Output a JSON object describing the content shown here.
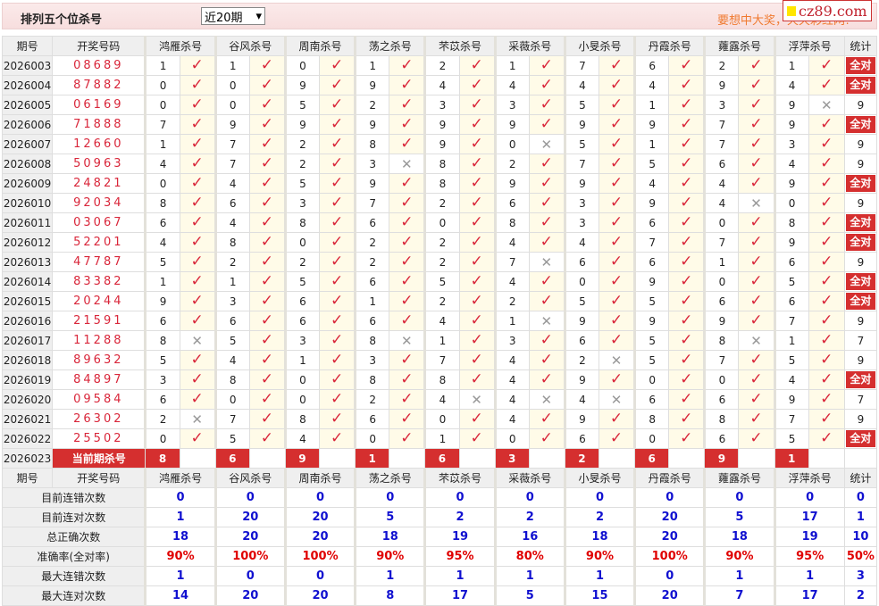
{
  "header": {
    "title": "排列五个位杀号",
    "period_select": "近20期",
    "slogan": "要想中大奖，天天彩红网!",
    "logo": "cz89.com"
  },
  "columns": {
    "issue": "期号",
    "draw": "开奖号码",
    "experts": [
      "鸿雁杀号",
      "谷风杀号",
      "周南杀号",
      "荡之杀号",
      "芣苡杀号",
      "采薇杀号",
      "小旻杀号",
      "丹霞杀号",
      "蕹露杀号",
      "浮萍杀号"
    ],
    "stat": "统计"
  },
  "all_correct_label": "全对",
  "rows": [
    {
      "issue": "2026003",
      "draw": "08689",
      "kills": [
        1,
        1,
        0,
        1,
        2,
        1,
        7,
        6,
        2,
        1
      ],
      "ok": [
        1,
        1,
        1,
        1,
        1,
        1,
        1,
        1,
        1,
        1
      ],
      "stat": "全对"
    },
    {
      "issue": "2026004",
      "draw": "87882",
      "kills": [
        0,
        0,
        9,
        9,
        4,
        4,
        4,
        4,
        9,
        4
      ],
      "ok": [
        1,
        1,
        1,
        1,
        1,
        1,
        1,
        1,
        1,
        1
      ],
      "stat": "全对"
    },
    {
      "issue": "2026005",
      "draw": "06169",
      "kills": [
        0,
        0,
        5,
        2,
        3,
        3,
        5,
        1,
        3,
        9
      ],
      "ok": [
        1,
        1,
        1,
        1,
        1,
        1,
        1,
        1,
        1,
        0
      ],
      "stat": "9"
    },
    {
      "issue": "2026006",
      "draw": "71888",
      "kills": [
        7,
        9,
        9,
        9,
        9,
        9,
        9,
        9,
        7,
        9
      ],
      "ok": [
        1,
        1,
        1,
        1,
        1,
        1,
        1,
        1,
        1,
        1
      ],
      "stat": "全对"
    },
    {
      "issue": "2026007",
      "draw": "12660",
      "kills": [
        1,
        7,
        2,
        8,
        9,
        0,
        5,
        1,
        7,
        3
      ],
      "ok": [
        1,
        1,
        1,
        1,
        1,
        0,
        1,
        1,
        1,
        1
      ],
      "stat": "9"
    },
    {
      "issue": "2026008",
      "draw": "50963",
      "kills": [
        4,
        7,
        2,
        3,
        8,
        2,
        7,
        5,
        6,
        4
      ],
      "ok": [
        1,
        1,
        1,
        0,
        1,
        1,
        1,
        1,
        1,
        1
      ],
      "stat": "9"
    },
    {
      "issue": "2026009",
      "draw": "24821",
      "kills": [
        0,
        4,
        5,
        9,
        8,
        9,
        9,
        4,
        4,
        9
      ],
      "ok": [
        1,
        1,
        1,
        1,
        1,
        1,
        1,
        1,
        1,
        1
      ],
      "stat": "全对"
    },
    {
      "issue": "2026010",
      "draw": "92034",
      "kills": [
        8,
        6,
        3,
        7,
        2,
        6,
        3,
        9,
        4,
        0
      ],
      "ok": [
        1,
        1,
        1,
        1,
        1,
        1,
        1,
        1,
        0,
        1
      ],
      "stat": "9"
    },
    {
      "issue": "2026011",
      "draw": "03067",
      "kills": [
        6,
        4,
        8,
        6,
        0,
        8,
        3,
        6,
        0,
        8
      ],
      "ok": [
        1,
        1,
        1,
        1,
        1,
        1,
        1,
        1,
        1,
        1
      ],
      "stat": "全对"
    },
    {
      "issue": "2026012",
      "draw": "52201",
      "kills": [
        4,
        8,
        0,
        2,
        2,
        4,
        4,
        7,
        7,
        9
      ],
      "ok": [
        1,
        1,
        1,
        1,
        1,
        1,
        1,
        1,
        1,
        1
      ],
      "stat": "全对"
    },
    {
      "issue": "2026013",
      "draw": "47787",
      "kills": [
        5,
        2,
        2,
        2,
        2,
        7,
        6,
        6,
        1,
        6
      ],
      "ok": [
        1,
        1,
        1,
        1,
        1,
        0,
        1,
        1,
        1,
        1
      ],
      "stat": "9"
    },
    {
      "issue": "2026014",
      "draw": "83382",
      "kills": [
        1,
        1,
        5,
        6,
        5,
        4,
        0,
        9,
        0,
        5
      ],
      "ok": [
        1,
        1,
        1,
        1,
        1,
        1,
        1,
        1,
        1,
        1
      ],
      "stat": "全对"
    },
    {
      "issue": "2026015",
      "draw": "20244",
      "kills": [
        9,
        3,
        6,
        1,
        2,
        2,
        5,
        5,
        6,
        6
      ],
      "ok": [
        1,
        1,
        1,
        1,
        1,
        1,
        1,
        1,
        1,
        1
      ],
      "stat": "全对"
    },
    {
      "issue": "2026016",
      "draw": "21591",
      "kills": [
        6,
        6,
        6,
        6,
        4,
        1,
        9,
        9,
        9,
        7
      ],
      "ok": [
        1,
        1,
        1,
        1,
        1,
        0,
        1,
        1,
        1,
        1
      ],
      "stat": "9"
    },
    {
      "issue": "2026017",
      "draw": "11288",
      "kills": [
        8,
        5,
        3,
        8,
        1,
        3,
        6,
        5,
        8,
        1
      ],
      "ok": [
        0,
        1,
        1,
        0,
        1,
        1,
        1,
        1,
        0,
        1
      ],
      "stat": "7"
    },
    {
      "issue": "2026018",
      "draw": "89632",
      "kills": [
        5,
        4,
        1,
        3,
        7,
        4,
        2,
        5,
        7,
        5
      ],
      "ok": [
        1,
        1,
        1,
        1,
        1,
        1,
        0,
        1,
        1,
        1
      ],
      "stat": "9"
    },
    {
      "issue": "2026019",
      "draw": "84897",
      "kills": [
        3,
        8,
        0,
        8,
        8,
        4,
        9,
        0,
        0,
        4
      ],
      "ok": [
        1,
        1,
        1,
        1,
        1,
        1,
        1,
        1,
        1,
        1
      ],
      "stat": "全对"
    },
    {
      "issue": "2026020",
      "draw": "09584",
      "kills": [
        6,
        0,
        0,
        2,
        4,
        4,
        4,
        6,
        6,
        9
      ],
      "ok": [
        1,
        1,
        1,
        1,
        0,
        0,
        0,
        1,
        1,
        1
      ],
      "stat": "7"
    },
    {
      "issue": "2026021",
      "draw": "26302",
      "kills": [
        2,
        7,
        8,
        6,
        0,
        4,
        9,
        8,
        8,
        7
      ],
      "ok": [
        0,
        1,
        1,
        1,
        1,
        1,
        1,
        1,
        1,
        1
      ],
      "stat": "9"
    },
    {
      "issue": "2026022",
      "draw": "25502",
      "kills": [
        0,
        5,
        4,
        0,
        1,
        0,
        6,
        0,
        6,
        5
      ],
      "ok": [
        1,
        1,
        1,
        1,
        1,
        1,
        1,
        1,
        1,
        1
      ],
      "stat": "全对"
    }
  ],
  "current": {
    "issue": "2026023",
    "label": "当前期杀号",
    "kills": [
      "8",
      "6",
      "9",
      "1",
      "6",
      "3",
      "2",
      "6",
      "9",
      "1"
    ]
  },
  "stats": [
    {
      "label": "目前连错次数",
      "values": [
        "0",
        "0",
        "0",
        "0",
        "0",
        "0",
        "0",
        "0",
        "0",
        "0"
      ],
      "total": "0"
    },
    {
      "label": "目前连对次数",
      "values": [
        "1",
        "20",
        "20",
        "5",
        "2",
        "2",
        "2",
        "20",
        "5",
        "17"
      ],
      "total": "1"
    },
    {
      "label": "总正确次数",
      "values": [
        "18",
        "20",
        "20",
        "18",
        "19",
        "16",
        "18",
        "20",
        "18",
        "19"
      ],
      "total": "10"
    },
    {
      "label": "准确率(全对率)",
      "values": [
        "90%",
        "100%",
        "100%",
        "90%",
        "95%",
        "80%",
        "90%",
        "100%",
        "90%",
        "95%"
      ],
      "total": "50%",
      "pct": true
    },
    {
      "label": "最大连错次数",
      "values": [
        "1",
        "0",
        "0",
        "1",
        "1",
        "1",
        "1",
        "0",
        "1",
        "1"
      ],
      "total": "3"
    },
    {
      "label": "最大连对次数",
      "values": [
        "14",
        "20",
        "20",
        "8",
        "17",
        "5",
        "15",
        "20",
        "7",
        "17"
      ],
      "total": "2"
    }
  ],
  "colors": {
    "accent": "#d52f2f",
    "check": "#d9263a",
    "stat_value": "#1010d0",
    "percent": "#e00000"
  }
}
